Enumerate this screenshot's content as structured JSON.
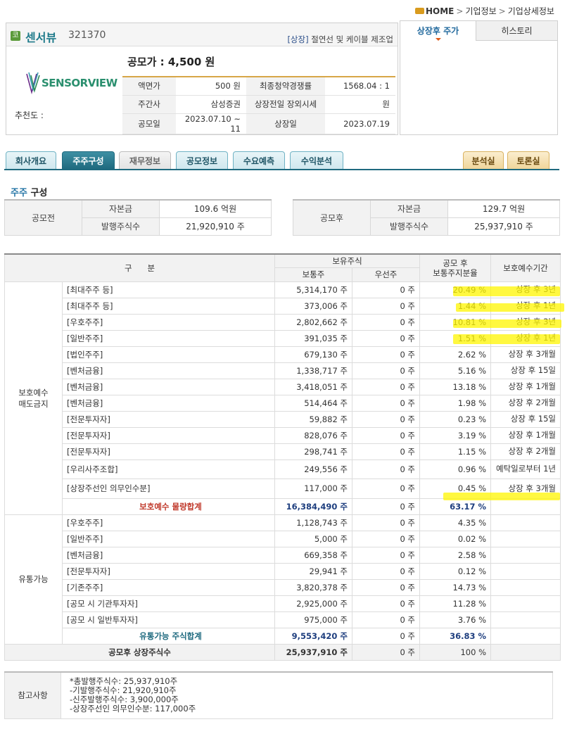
{
  "breadcrumb": [
    "HOME",
    "기업정보",
    "기업상세정보"
  ],
  "company": {
    "badge": "코",
    "name": "센서뷰",
    "code": "321370",
    "market": "[상장]",
    "industry": "절연선 및 케이블 제조업",
    "logo_text": "SENSORVIEW",
    "recommend_label": "추천도 :",
    "ipo_price_text": "공모가 : 4,500 원"
  },
  "info_rows": [
    {
      "l1": "액면가",
      "v1": "500 원",
      "l2": "최종청약경쟁률",
      "v2": "1568.04 : 1"
    },
    {
      "l1": "주간사",
      "v1": "삼성증권",
      "l2": "상장전일 장외시세",
      "v2": "원"
    },
    {
      "l1": "공모일",
      "v1": "2023.07.10 ~ 11",
      "l2": "상장일",
      "v2": "2023.07.19"
    }
  ],
  "right_panel": {
    "tab_active": "상장후 주가",
    "tab_other": "히스토리"
  },
  "nav_tabs": [
    "회사개요",
    "주주구성",
    "재무정보",
    "공모정보",
    "수요예측",
    "수익분석",
    "분석실",
    "토론실"
  ],
  "section": {
    "accent": "주주",
    "rest": " 구성"
  },
  "before": {
    "title": "공모전",
    "r1_label": "자본금",
    "r1_value": "109.6 억원",
    "r2_label": "발행주식수",
    "r2_value": "21,920,910 주"
  },
  "after": {
    "title": "공모후",
    "r1_label": "자본금",
    "r1_value": "129.7 억원",
    "r2_label": "발행주식수",
    "r2_value": "25,937,910 주"
  },
  "table": {
    "headers": {
      "category": "구      분",
      "holding": "보유주식",
      "common": "보통주",
      "preferred": "우선주",
      "ratio": "공모 후\n보통주지분율",
      "lockup": "보호예수기간"
    },
    "group1": "보호예수\n매도금지",
    "rows1": [
      {
        "cat": "[최대주주 등]",
        "common": "5,314,170 주",
        "pref": "0 주",
        "ratio": "20.49 %",
        "lock": "상장 후 3년"
      },
      {
        "cat": "[최대주주 등]",
        "common": "373,006 주",
        "pref": "0 주",
        "ratio": "1.44 %",
        "lock": "상장 후 1년"
      },
      {
        "cat": "[우호주주]",
        "common": "2,802,662 주",
        "pref": "0 주",
        "ratio": "10.81 %",
        "lock": "상장 후 3년"
      },
      {
        "cat": "[일반주주]",
        "common": "391,035 주",
        "pref": "0 주",
        "ratio": "1.51 %",
        "lock": "상장 후 1년"
      },
      {
        "cat": "[법인주주]",
        "common": "679,130 주",
        "pref": "0 주",
        "ratio": "2.62 %",
        "lock": "상장 후 3개월"
      },
      {
        "cat": "[벤처금융]",
        "common": "1,338,717 주",
        "pref": "0 주",
        "ratio": "5.16 %",
        "lock": "상장 후 15일"
      },
      {
        "cat": "[벤처금융]",
        "common": "3,418,051 주",
        "pref": "0 주",
        "ratio": "13.18 %",
        "lock": "상장 후 1개월"
      },
      {
        "cat": "[벤처금융]",
        "common": "514,464 주",
        "pref": "0 주",
        "ratio": "1.98 %",
        "lock": "상장 후 2개월"
      },
      {
        "cat": "[전문투자자]",
        "common": "59,882 주",
        "pref": "0 주",
        "ratio": "0.23 %",
        "lock": "상장 후 15일"
      },
      {
        "cat": "[전문투자자]",
        "common": "828,076 주",
        "pref": "0 주",
        "ratio": "3.19 %",
        "lock": "상장 후 1개월"
      },
      {
        "cat": "[전문투자자]",
        "common": "298,741 주",
        "pref": "0 주",
        "ratio": "1.15 %",
        "lock": "상장 후 2개월"
      },
      {
        "cat": "[우리사주조합]",
        "common": "249,556 주",
        "pref": "0 주",
        "ratio": "0.96 %",
        "lock": "예탁일로부터 1년"
      },
      {
        "cat": "[상장주선인 의무인수분]",
        "common": "117,000 주",
        "pref": "0 주",
        "ratio": "0.45 %",
        "lock": "상장 후 3개월"
      }
    ],
    "subtotal1": {
      "cat": "보호예수 물량합계",
      "common": "16,384,490 주",
      "pref": "0 주",
      "ratio": "63.17 %"
    },
    "group2": "유통가능",
    "rows2": [
      {
        "cat": "[우호주주]",
        "common": "1,128,743 주",
        "pref": "0 주",
        "ratio": "4.35 %"
      },
      {
        "cat": "[일반주주]",
        "common": "5,000 주",
        "pref": "0 주",
        "ratio": "0.02 %"
      },
      {
        "cat": "[벤처금융]",
        "common": "669,358 주",
        "pref": "0 주",
        "ratio": "2.58 %"
      },
      {
        "cat": "[전문투자자]",
        "common": "29,941 주",
        "pref": "0 주",
        "ratio": "0.12 %"
      },
      {
        "cat": "[기존주주]",
        "common": "3,820,378 주",
        "pref": "0 주",
        "ratio": "14.73 %"
      },
      {
        "cat": "[공모 시 기관투자자]",
        "common": "2,925,000 주",
        "pref": "0 주",
        "ratio": "11.28 %"
      },
      {
        "cat": "[공모 시 일반투자자]",
        "common": "975,000 주",
        "pref": "0 주",
        "ratio": "3.76 %"
      }
    ],
    "subtotal2": {
      "cat": "유통가능 주식합계",
      "common": "9,553,420 주",
      "pref": "0 주",
      "ratio": "36.83 %"
    },
    "total": {
      "label": "공모후 상장주식수",
      "common": "25,937,910 주",
      "pref": "0 주",
      "ratio": "100 %"
    }
  },
  "notes": {
    "label": "참고사항",
    "lines": [
      "*총발행주식수: 25,937,910주",
      "-기발행주식수: 21,920,910주",
      "-신주발행주식수: 3,900,000주",
      "-상장주선인 의무인수분: 117,000주"
    ]
  }
}
